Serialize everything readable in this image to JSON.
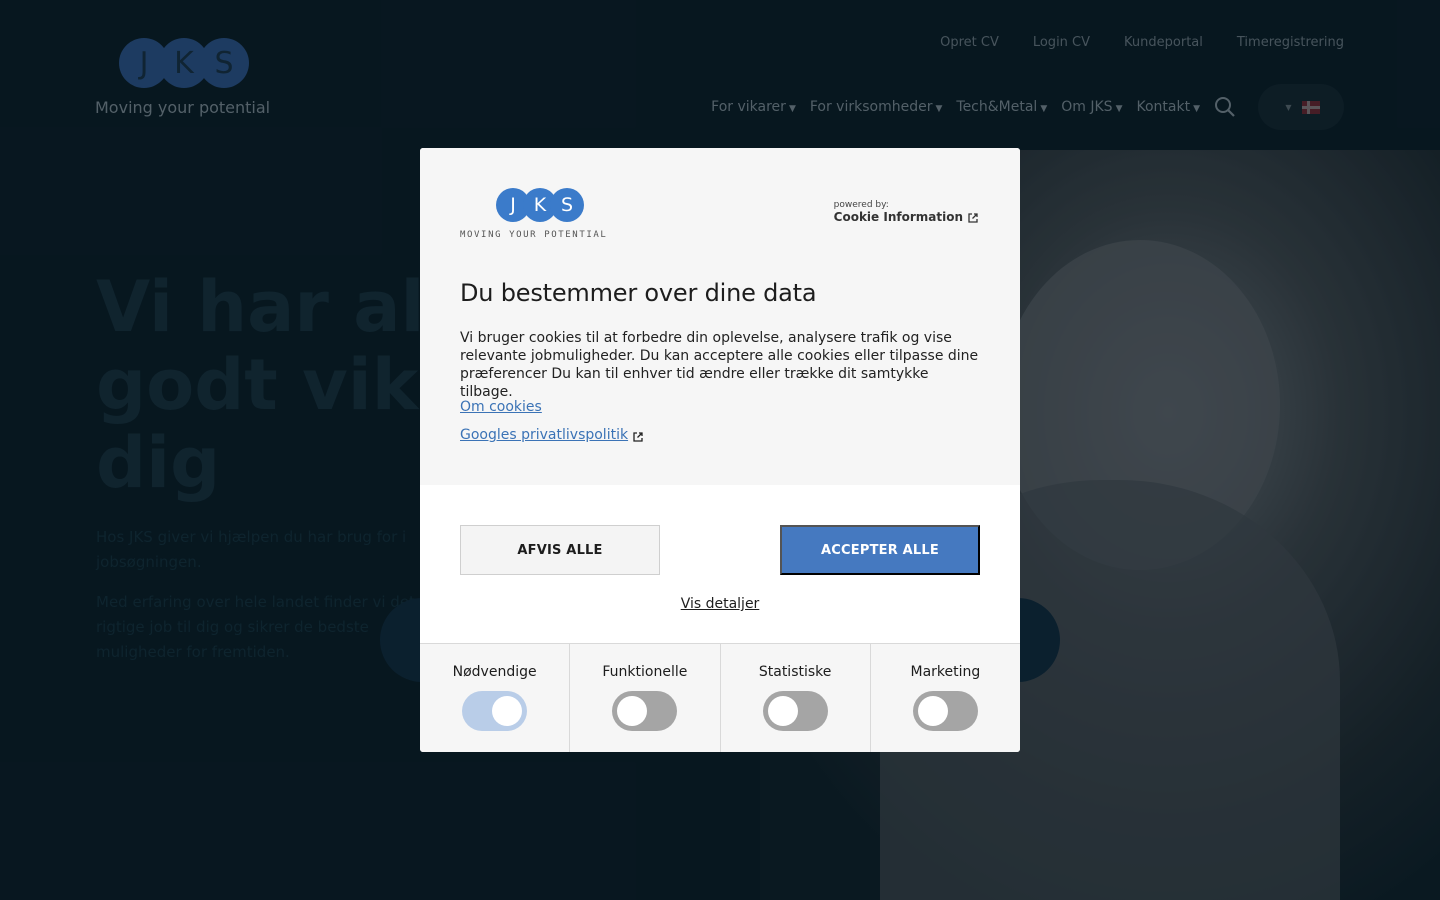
{
  "header": {
    "logo_letters": [
      "J",
      "K",
      "S"
    ],
    "tagline": "Moving your potential",
    "top_links": [
      "Opret CV",
      "Login CV",
      "Kundeportal",
      "Timeregistrering"
    ],
    "nav": [
      "For vikarer",
      "For virksomheder",
      "Tech&Metal",
      "Om JKS",
      "Kontakt"
    ],
    "search_icon": "search-icon",
    "language_flag": "danish-flag-icon"
  },
  "hero": {
    "title": "Vi har altid et godt vikarjob til dig",
    "text_1": "Hos JKS giver vi hjælpen du har brug for i jobsøgningen.",
    "text_2": "Med erfaring over hele landet finder vi det rigtige job til dig og sikrer de bedste muligheder for fremtiden."
  },
  "dialog": {
    "logo_letters": [
      "J",
      "K",
      "S"
    ],
    "logo_tagline": "MOVING YOUR POTENTIAL",
    "powered_label": "powered by:",
    "powered_name": "Cookie Information",
    "heading": "Du bestemmer over dine data",
    "body": "Vi bruger cookies til at forbedre din oplevelse, analysere trafik og vise relevante jobmuligheder. Du kan acceptere alle cookies eller tilpasse dine præferencer Du kan til enhver tid ændre eller trække dit samtykke tilbage.",
    "link_cookies": "Om cookies",
    "link_privacy": "Googles privatlivspolitik",
    "reject_label": "AFVIS ALLE",
    "accept_label": "ACCEPTER ALLE",
    "details_label": "Vis detaljer",
    "categories": [
      {
        "label": "Nødvendige",
        "enabled": true,
        "locked": true
      },
      {
        "label": "Funktionelle",
        "enabled": false
      },
      {
        "label": "Statistiske",
        "enabled": false
      },
      {
        "label": "Marketing",
        "enabled": false
      }
    ],
    "colors": {
      "accent": "#4579c0",
      "logo_blue": "#3b7bca",
      "link": "#3b73b6"
    }
  }
}
